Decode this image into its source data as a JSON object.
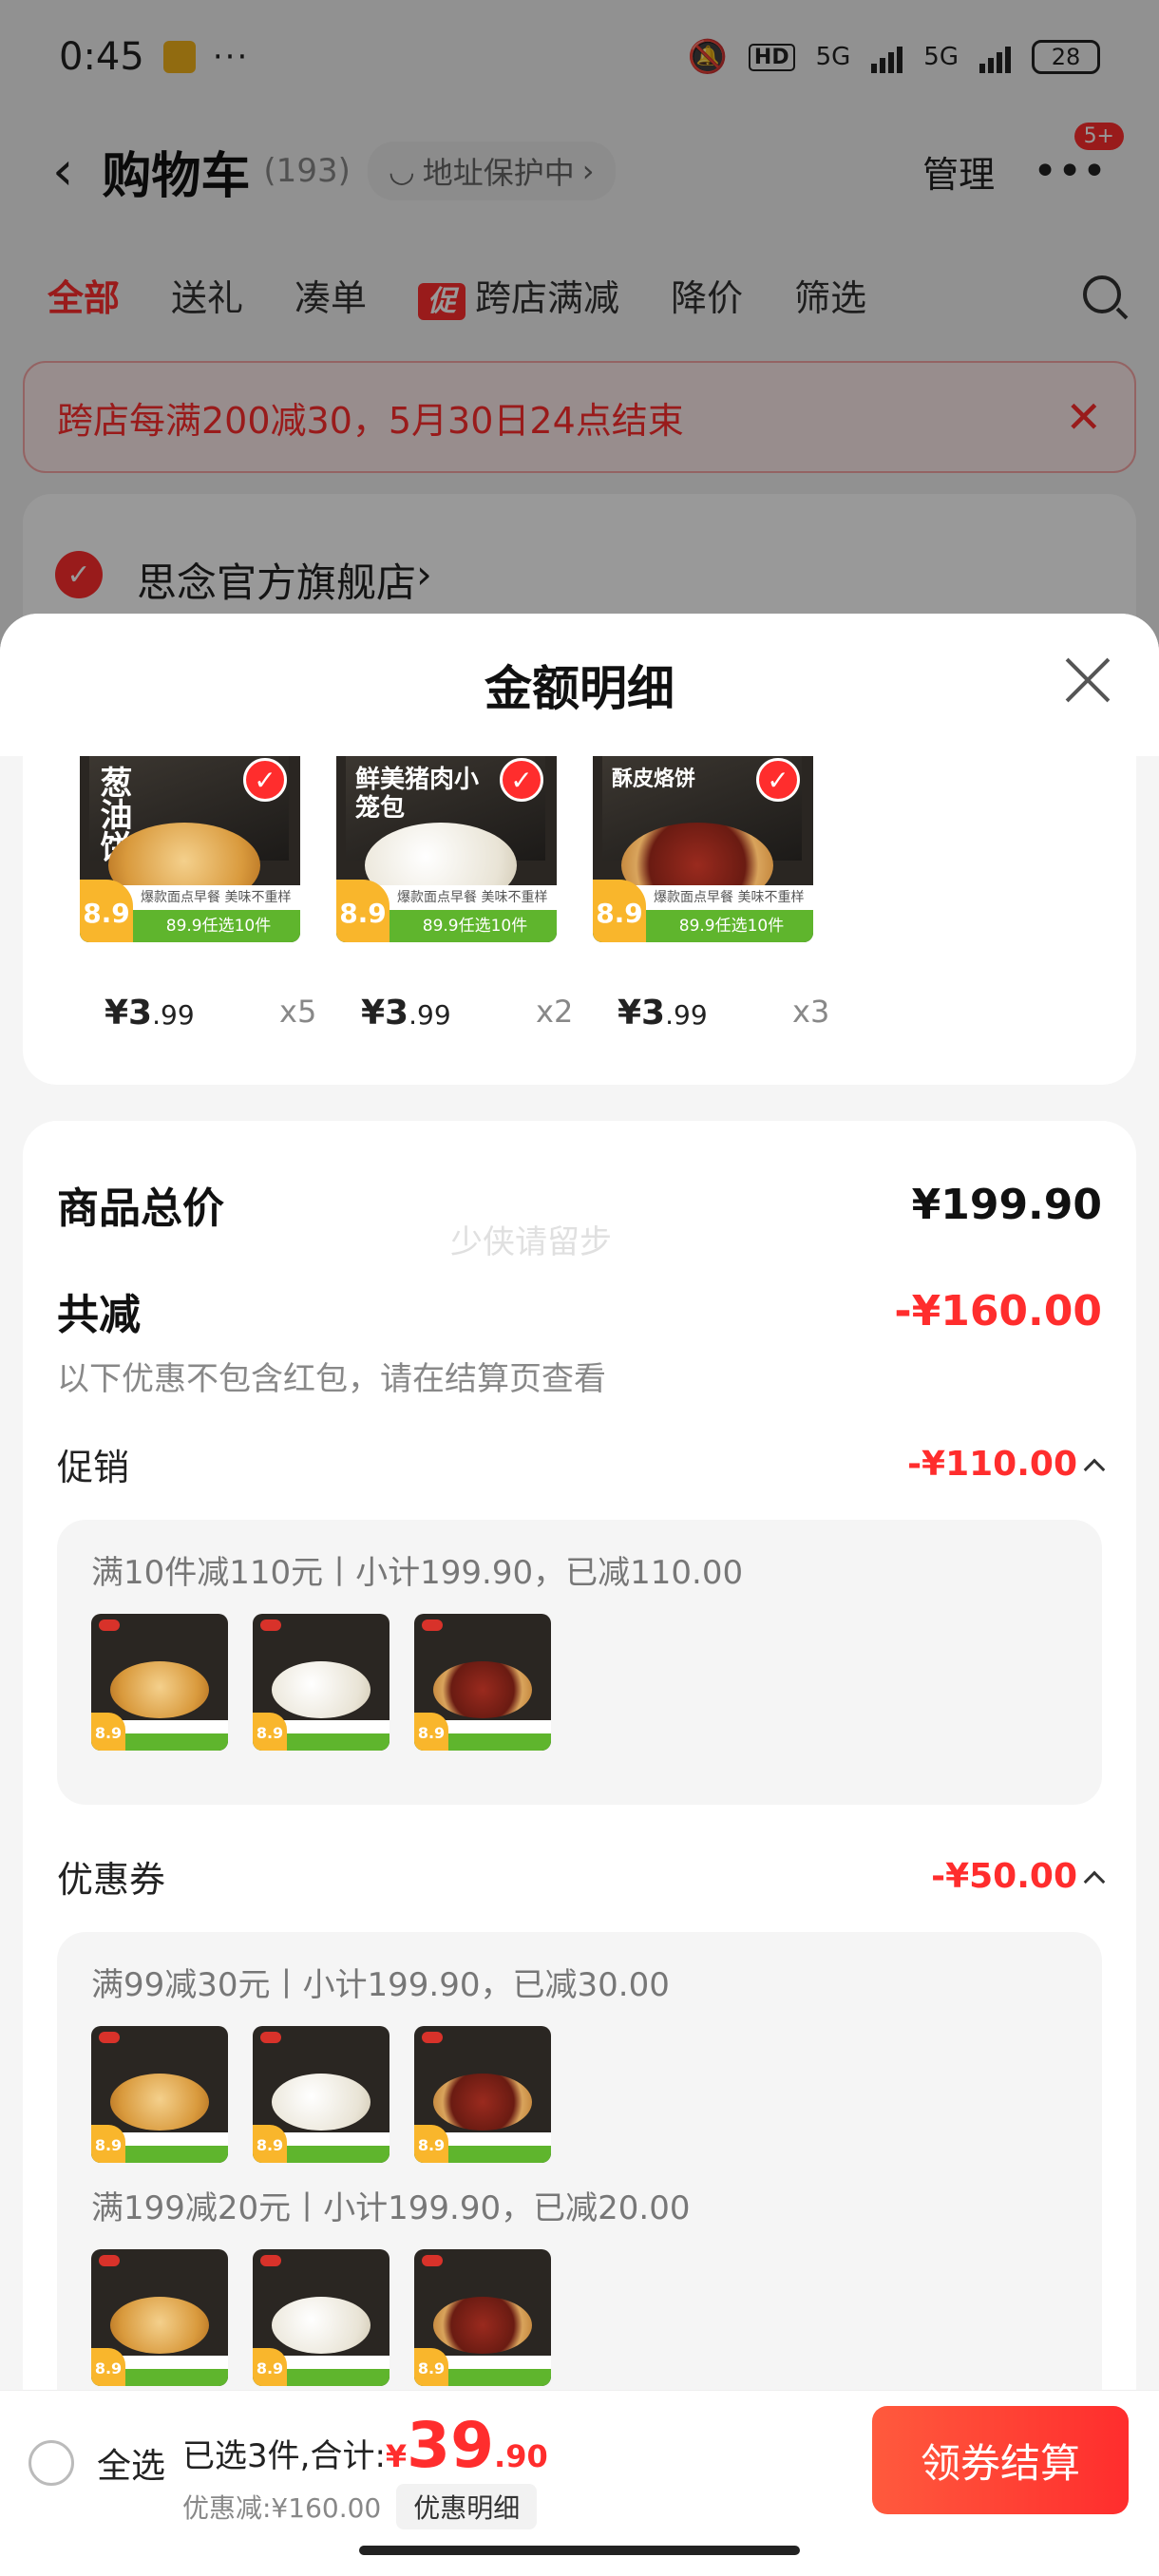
{
  "status": {
    "time": "0:45",
    "dots": "···",
    "hd": "HD",
    "net1": "5G",
    "net2": "5G",
    "battery": "28"
  },
  "nav": {
    "title": "购物车",
    "count": "(193)",
    "addr": "地址保护中",
    "manage": "管理",
    "more_badge": "5+"
  },
  "tabs": [
    {
      "label": "全部",
      "active": true
    },
    {
      "label": "送礼"
    },
    {
      "label": "凑单"
    },
    {
      "label": "跨店满减",
      "tag": "促"
    },
    {
      "label": "降价"
    },
    {
      "label": "筛选"
    }
  ],
  "banner": {
    "text": "跨店每满200减30，5月30日24点结束"
  },
  "shop": {
    "name": "思念官方旗舰店"
  },
  "sheet": {
    "title": "金额明细"
  },
  "items": [
    {
      "name": "葱油饼",
      "price": "¥3",
      "price_dec": ".99",
      "qty": "x5",
      "tag": "8.9",
      "stripe": "89.9任选10件",
      "sub": "爆款面点早餐 美味不重样",
      "food": "pancake"
    },
    {
      "name": "鲜美猪肉小笼包",
      "price": "¥3",
      "price_dec": ".99",
      "qty": "x2",
      "tag": "8.9",
      "stripe": "89.9任选10件",
      "sub": "爆款面点早餐 美味不重样",
      "food": "bun"
    },
    {
      "name": "酥皮烙饼",
      "price": "¥3",
      "price_dec": ".99",
      "qty": "x3",
      "tag": "8.9",
      "stripe": "89.9任选10件",
      "sub": "爆款面点早餐 美味不重样",
      "food": "meat"
    }
  ],
  "detail": {
    "total_label": "商品总价",
    "total_value": "¥199.90",
    "reduce_label": "共减",
    "reduce_value": "-¥160.00",
    "note": "以下优惠不包含红包，请在结算页查看",
    "watermark": "少侠请留步",
    "promo_label": "促销",
    "promo_value": "-¥110.00",
    "promo_line": "满10件减110元丨小计199.90，已减110.00",
    "coupon_label": "优惠券",
    "coupon_value": "-¥50.00",
    "coupon_line1": "满99减30元丨小计199.90，已减30.00",
    "coupon_line2": "满199减20元丨小计199.90，已减20.00"
  },
  "bottom": {
    "select_all": "全选",
    "selected_text": "已选3件,合计:",
    "yen": "¥",
    "int": "39",
    "dec": ".90",
    "discount": "优惠减:¥160.00",
    "detail_btn": "优惠明细",
    "checkout": "领券结算"
  },
  "colors": {
    "accent": "#ff2d2d",
    "green": "#5fb52d",
    "tag": "#f9b62c"
  }
}
